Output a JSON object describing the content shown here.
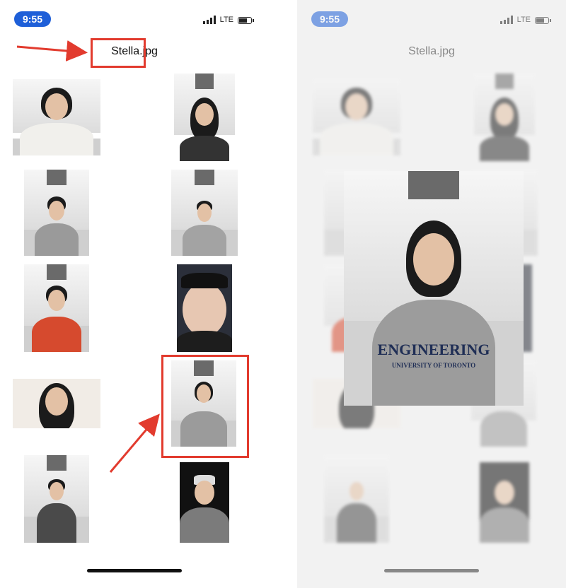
{
  "status": {
    "time": "9:55",
    "network": "LTE"
  },
  "file": {
    "name": "Stella.jpg"
  },
  "preview": {
    "hoodie_line1": "ENGINEERING",
    "hoodie_line2": "UNIVERSITY OF TORONTO"
  },
  "colors": {
    "accent_blue": "#1e5fd8",
    "annotation_red": "#e23b2e"
  }
}
